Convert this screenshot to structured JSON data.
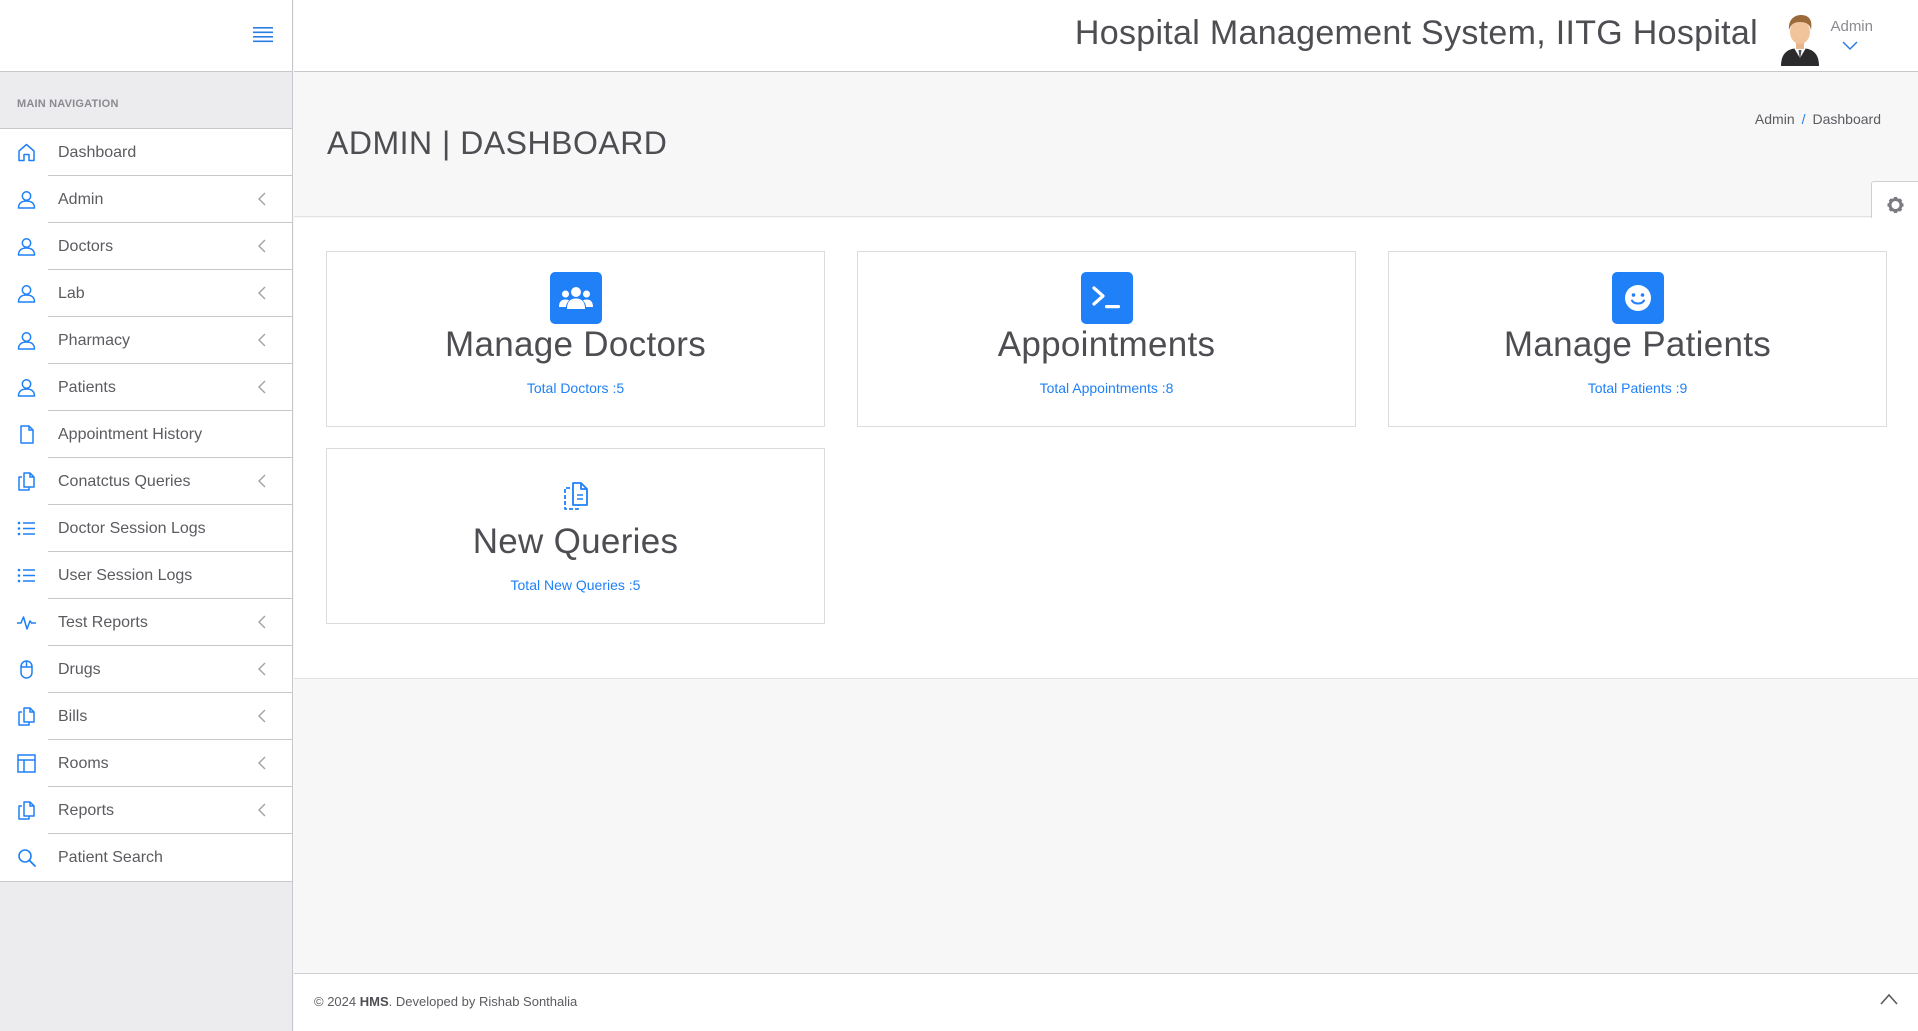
{
  "app": {
    "title": "Hospital Management System, IITG Hospital",
    "user_label": "Admin"
  },
  "sidebar": {
    "section_header": "MAIN NAVIGATION",
    "items": [
      {
        "label": "Dashboard",
        "icon": "home-icon",
        "has_submenu": false
      },
      {
        "label": "Admin",
        "icon": "user-icon",
        "has_submenu": true
      },
      {
        "label": "Doctors",
        "icon": "user-icon",
        "has_submenu": true
      },
      {
        "label": "Lab",
        "icon": "user-icon",
        "has_submenu": true
      },
      {
        "label": "Pharmacy",
        "icon": "user-icon",
        "has_submenu": true
      },
      {
        "label": "Patients",
        "icon": "user-icon",
        "has_submenu": true
      },
      {
        "label": "Appointment History",
        "icon": "file-icon",
        "has_submenu": false
      },
      {
        "label": "Conatctus Queries",
        "icon": "files-icon",
        "has_submenu": true
      },
      {
        "label": "Doctor Session Logs",
        "icon": "list-icon",
        "has_submenu": false
      },
      {
        "label": "User Session Logs",
        "icon": "list-icon",
        "has_submenu": false
      },
      {
        "label": "Test Reports",
        "icon": "pulse-icon",
        "has_submenu": true
      },
      {
        "label": "Drugs",
        "icon": "mouse-icon",
        "has_submenu": true
      },
      {
        "label": "Bills",
        "icon": "files-icon",
        "has_submenu": true
      },
      {
        "label": "Rooms",
        "icon": "layout-icon",
        "has_submenu": true
      },
      {
        "label": "Reports",
        "icon": "files-icon",
        "has_submenu": true
      },
      {
        "label": "Patient Search",
        "icon": "search-icon",
        "has_submenu": false
      }
    ]
  },
  "header": {
    "page_title": "ADMIN | DASHBOARD",
    "breadcrumb": [
      "Admin",
      "Dashboard"
    ],
    "breadcrumb_separator": "/"
  },
  "cards": [
    {
      "title": "Manage Doctors",
      "count_text": "Total Doctors :5",
      "icon": "users-icon"
    },
    {
      "title": "Appointments",
      "count_text": "Total Appointments :8",
      "icon": "terminal-icon"
    },
    {
      "title": "Manage Patients",
      "count_text": "Total Patients :9",
      "icon": "smile-icon"
    },
    {
      "title": "New Queries",
      "count_text": "Total New Queries :5",
      "icon": "files-icon"
    }
  ],
  "footer": {
    "copyright_prefix": "© 2024",
    "brand": "HMS",
    "suffix": ". Developed by Rishab Sonthalia"
  },
  "colors": {
    "accent": "#1f80f7",
    "sidebar_bg": "#ececee",
    "text": "#5b5b60"
  }
}
